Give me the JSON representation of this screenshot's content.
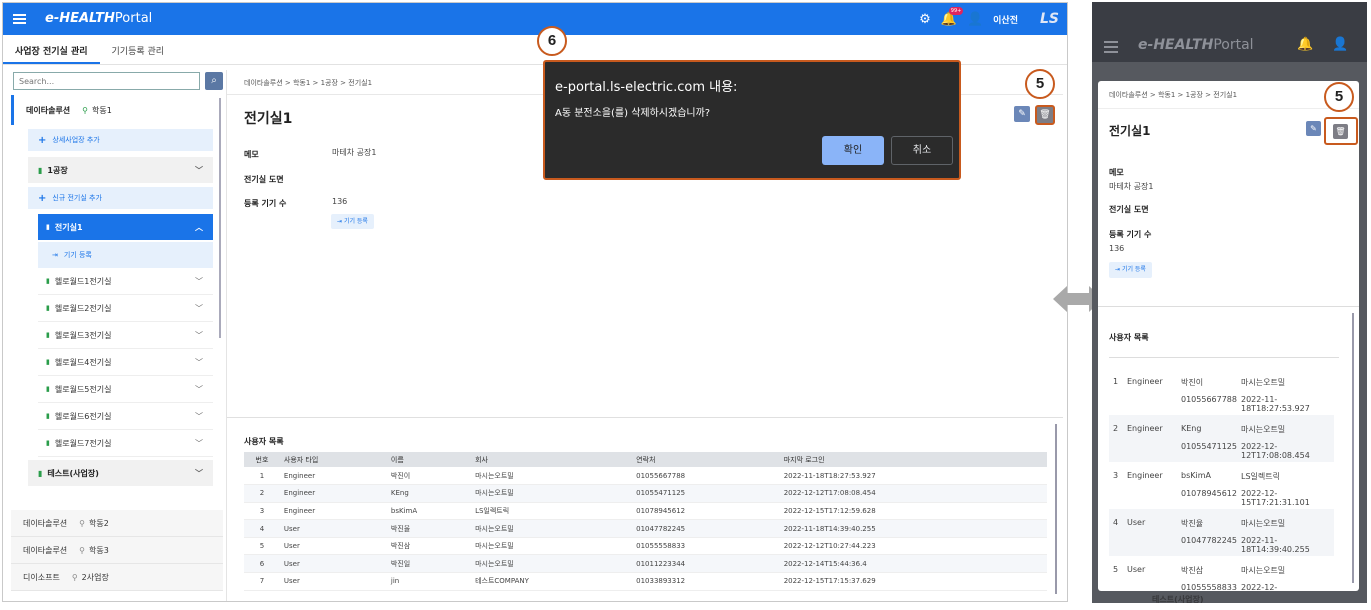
{
  "app": {
    "brand_prefix": "e-",
    "brand_health": "HEALTH",
    "brand_portal": "Portal",
    "notif_badge": "99+",
    "username": "이산전",
    "logo": "LS"
  },
  "tabs": [
    "사업장 전기실 관리",
    "기기등록 관리"
  ],
  "search": {
    "placeholder": "Search..."
  },
  "tree": {
    "site": "데이타솔루션",
    "site_loc": "학동1",
    "add_detail": "상세사업장 추가",
    "factory": "1공장",
    "add_room": "신규 전기실 추가",
    "active_room": "전기실1",
    "device_reg": "기기 등록",
    "rooms": [
      "헬로월드1전기실",
      "헬로월드2전기실",
      "헬로월드3전기실",
      "헬로월드4전기실",
      "헬로월드5전기실",
      "헬로월드6전기실",
      "헬로월드7전기실"
    ],
    "factory2": "테스트(사업장)",
    "others": [
      {
        "name": "데이타솔루션",
        "loc": "학동2"
      },
      {
        "name": "데이타솔루션",
        "loc": "학동3"
      },
      {
        "name": "디이소프트",
        "loc": "2사업장"
      }
    ]
  },
  "detail": {
    "breadcrumb": "데이타솔루션 > 학동1 > 1공장 > 전기실1",
    "title": "전기실1",
    "memo_label": "메모",
    "memo_value": "마테차 공장1",
    "drawing_label": "전기실 도면",
    "count_label": "등록 기기 수",
    "count_value": "136",
    "device_btn": "기기 등록"
  },
  "users": {
    "title": "사용자 목록",
    "columns": [
      "번호",
      "사용자 타입",
      "이름",
      "회사",
      "연락처",
      "마지막 로그인"
    ],
    "rows": [
      [
        "1",
        "Engineer",
        "박진이",
        "마시는오트밀",
        "01055667788",
        "2022-11-18T18:27:53.927"
      ],
      [
        "2",
        "Engineer",
        "KEng",
        "마시는오트밀",
        "01055471125",
        "2022-12-12T17:08:08.454"
      ],
      [
        "3",
        "Engineer",
        "bsKimA",
        "LS일렉트릭",
        "01078945612",
        "2022-12-15T17:12:59.628"
      ],
      [
        "4",
        "User",
        "박진율",
        "마시는오트밀",
        "01047782245",
        "2022-11-18T14:39:40.255"
      ],
      [
        "5",
        "User",
        "박진삼",
        "마시는오트밀",
        "01055558833",
        "2022-12-12T10:27:44.223"
      ],
      [
        "6",
        "User",
        "박진일",
        "마시는오트밀",
        "01011223344",
        "2022-12-14T15:44:36.4"
      ],
      [
        "7",
        "User",
        "jin",
        "테스트COMPANY",
        "01033893312",
        "2022-12-15T17:15:37.629"
      ]
    ]
  },
  "dialog": {
    "title": "e-portal.ls-electric.com 내용:",
    "message": "A동 분전소을(를) 삭제하시겠습니까?",
    "ok": "확인",
    "cancel": "취소"
  },
  "callouts": {
    "dialog": "6",
    "delete": "5",
    "delete_mobile": "5"
  },
  "mobile": {
    "breadcrumb": "데이타솔루션 > 학동1 > 1공장 > 전기실1",
    "title": "전기실1",
    "memo_label": "메모",
    "memo_value": "마테차 공장1",
    "drawing_label": "전기실 도면",
    "count_label": "등록 기기 수",
    "count_value": "136",
    "device_btn": "기기 등록",
    "users_title": "사용자 목록",
    "rows": [
      {
        "no": "1",
        "type": "Engineer",
        "name": "박진이",
        "company": "마시는오트밀",
        "phone": "01055667788",
        "login": "2022-11-18T18:27:53.927"
      },
      {
        "no": "2",
        "type": "Engineer",
        "name": "KEng",
        "company": "마시는오트밀",
        "phone": "01055471125",
        "login": "2022-12-12T17:08:08.454"
      },
      {
        "no": "3",
        "type": "Engineer",
        "name": "bsKimA",
        "company": "LS일렉트릭",
        "phone": "01078945612",
        "login": "2022-12-15T17:21:31.101"
      },
      {
        "no": "4",
        "type": "User",
        "name": "박진율",
        "company": "마시는오트밀",
        "phone": "01047782245",
        "login": "2022-11-18T14:39:40.255"
      },
      {
        "no": "5",
        "type": "User",
        "name": "박진삼",
        "company": "마시는오트밀",
        "phone": "01055558833",
        "login": "2022-12-12T10:27:44.223"
      }
    ],
    "cut_label": "테스트(사업장)"
  },
  "colors": {
    "primary": "#1a74e8",
    "callout": "#c85a1e",
    "dialog_bg": "#2b2b2b",
    "ok_button": "#8ab4f8"
  }
}
